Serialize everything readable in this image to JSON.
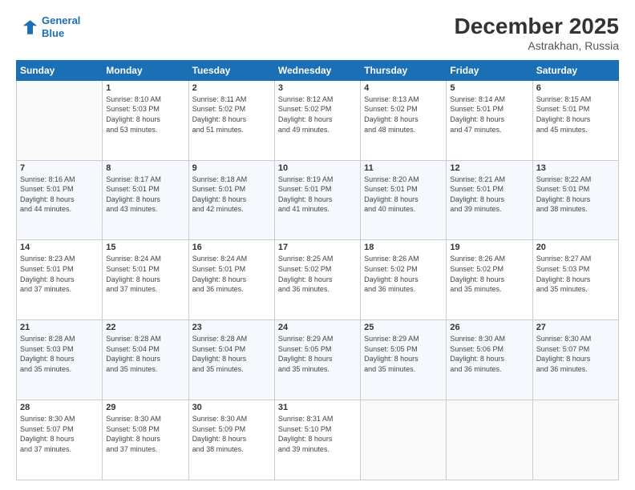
{
  "header": {
    "logo_line1": "General",
    "logo_line2": "Blue",
    "month": "December 2025",
    "location": "Astrakhan, Russia"
  },
  "weekdays": [
    "Sunday",
    "Monday",
    "Tuesday",
    "Wednesday",
    "Thursday",
    "Friday",
    "Saturday"
  ],
  "weeks": [
    [
      {
        "day": "",
        "info": ""
      },
      {
        "day": "1",
        "info": "Sunrise: 8:10 AM\nSunset: 5:03 PM\nDaylight: 8 hours\nand 53 minutes."
      },
      {
        "day": "2",
        "info": "Sunrise: 8:11 AM\nSunset: 5:02 PM\nDaylight: 8 hours\nand 51 minutes."
      },
      {
        "day": "3",
        "info": "Sunrise: 8:12 AM\nSunset: 5:02 PM\nDaylight: 8 hours\nand 49 minutes."
      },
      {
        "day": "4",
        "info": "Sunrise: 8:13 AM\nSunset: 5:02 PM\nDaylight: 8 hours\nand 48 minutes."
      },
      {
        "day": "5",
        "info": "Sunrise: 8:14 AM\nSunset: 5:01 PM\nDaylight: 8 hours\nand 47 minutes."
      },
      {
        "day": "6",
        "info": "Sunrise: 8:15 AM\nSunset: 5:01 PM\nDaylight: 8 hours\nand 45 minutes."
      }
    ],
    [
      {
        "day": "7",
        "info": "Sunrise: 8:16 AM\nSunset: 5:01 PM\nDaylight: 8 hours\nand 44 minutes."
      },
      {
        "day": "8",
        "info": "Sunrise: 8:17 AM\nSunset: 5:01 PM\nDaylight: 8 hours\nand 43 minutes."
      },
      {
        "day": "9",
        "info": "Sunrise: 8:18 AM\nSunset: 5:01 PM\nDaylight: 8 hours\nand 42 minutes."
      },
      {
        "day": "10",
        "info": "Sunrise: 8:19 AM\nSunset: 5:01 PM\nDaylight: 8 hours\nand 41 minutes."
      },
      {
        "day": "11",
        "info": "Sunrise: 8:20 AM\nSunset: 5:01 PM\nDaylight: 8 hours\nand 40 minutes."
      },
      {
        "day": "12",
        "info": "Sunrise: 8:21 AM\nSunset: 5:01 PM\nDaylight: 8 hours\nand 39 minutes."
      },
      {
        "day": "13",
        "info": "Sunrise: 8:22 AM\nSunset: 5:01 PM\nDaylight: 8 hours\nand 38 minutes."
      }
    ],
    [
      {
        "day": "14",
        "info": "Sunrise: 8:23 AM\nSunset: 5:01 PM\nDaylight: 8 hours\nand 37 minutes."
      },
      {
        "day": "15",
        "info": "Sunrise: 8:24 AM\nSunset: 5:01 PM\nDaylight: 8 hours\nand 37 minutes."
      },
      {
        "day": "16",
        "info": "Sunrise: 8:24 AM\nSunset: 5:01 PM\nDaylight: 8 hours\nand 36 minutes."
      },
      {
        "day": "17",
        "info": "Sunrise: 8:25 AM\nSunset: 5:02 PM\nDaylight: 8 hours\nand 36 minutes."
      },
      {
        "day": "18",
        "info": "Sunrise: 8:26 AM\nSunset: 5:02 PM\nDaylight: 8 hours\nand 36 minutes."
      },
      {
        "day": "19",
        "info": "Sunrise: 8:26 AM\nSunset: 5:02 PM\nDaylight: 8 hours\nand 35 minutes."
      },
      {
        "day": "20",
        "info": "Sunrise: 8:27 AM\nSunset: 5:03 PM\nDaylight: 8 hours\nand 35 minutes."
      }
    ],
    [
      {
        "day": "21",
        "info": "Sunrise: 8:28 AM\nSunset: 5:03 PM\nDaylight: 8 hours\nand 35 minutes."
      },
      {
        "day": "22",
        "info": "Sunrise: 8:28 AM\nSunset: 5:04 PM\nDaylight: 8 hours\nand 35 minutes."
      },
      {
        "day": "23",
        "info": "Sunrise: 8:28 AM\nSunset: 5:04 PM\nDaylight: 8 hours\nand 35 minutes."
      },
      {
        "day": "24",
        "info": "Sunrise: 8:29 AM\nSunset: 5:05 PM\nDaylight: 8 hours\nand 35 minutes."
      },
      {
        "day": "25",
        "info": "Sunrise: 8:29 AM\nSunset: 5:05 PM\nDaylight: 8 hours\nand 35 minutes."
      },
      {
        "day": "26",
        "info": "Sunrise: 8:30 AM\nSunset: 5:06 PM\nDaylight: 8 hours\nand 36 minutes."
      },
      {
        "day": "27",
        "info": "Sunrise: 8:30 AM\nSunset: 5:07 PM\nDaylight: 8 hours\nand 36 minutes."
      }
    ],
    [
      {
        "day": "28",
        "info": "Sunrise: 8:30 AM\nSunset: 5:07 PM\nDaylight: 8 hours\nand 37 minutes."
      },
      {
        "day": "29",
        "info": "Sunrise: 8:30 AM\nSunset: 5:08 PM\nDaylight: 8 hours\nand 37 minutes."
      },
      {
        "day": "30",
        "info": "Sunrise: 8:30 AM\nSunset: 5:09 PM\nDaylight: 8 hours\nand 38 minutes."
      },
      {
        "day": "31",
        "info": "Sunrise: 8:31 AM\nSunset: 5:10 PM\nDaylight: 8 hours\nand 39 minutes."
      },
      {
        "day": "",
        "info": ""
      },
      {
        "day": "",
        "info": ""
      },
      {
        "day": "",
        "info": ""
      }
    ]
  ]
}
